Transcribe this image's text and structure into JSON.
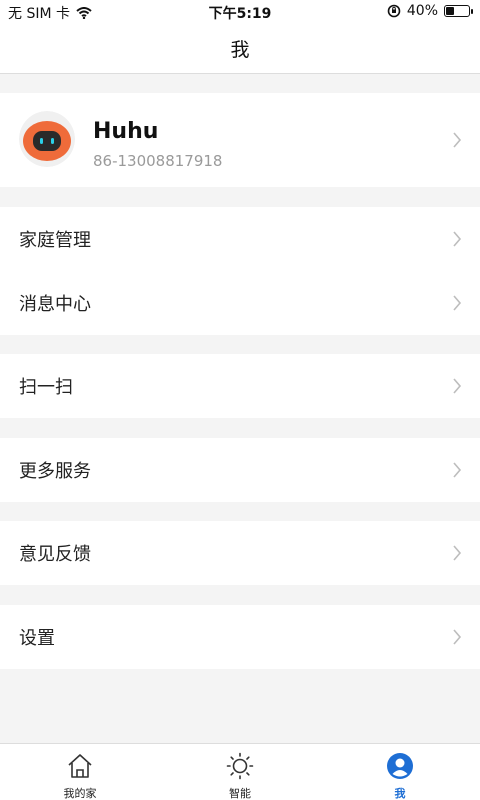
{
  "status_bar": {
    "carrier": "无 SIM 卡",
    "time": "下午5:19",
    "battery_percent": "40%",
    "battery_level": 0.4
  },
  "nav": {
    "title": "我"
  },
  "profile": {
    "name": "Huhu",
    "phone": "86-13008817918",
    "avatar_icon": "robot-avatar-icon",
    "avatar_color": "#ef6b3a"
  },
  "menu": {
    "family": "家庭管理",
    "messages": "消息中心",
    "scan": "扫一扫",
    "more_services": "更多服务",
    "feedback": "意见反馈",
    "settings": "设置"
  },
  "tabs": [
    {
      "label": "我的家",
      "icon": "home-icon",
      "active": false
    },
    {
      "label": "智能",
      "icon": "sun-icon",
      "active": false
    },
    {
      "label": "我",
      "icon": "user-icon",
      "active": true
    }
  ],
  "colors": {
    "accent": "#1e6ed4",
    "background": "#f4f4f4"
  }
}
